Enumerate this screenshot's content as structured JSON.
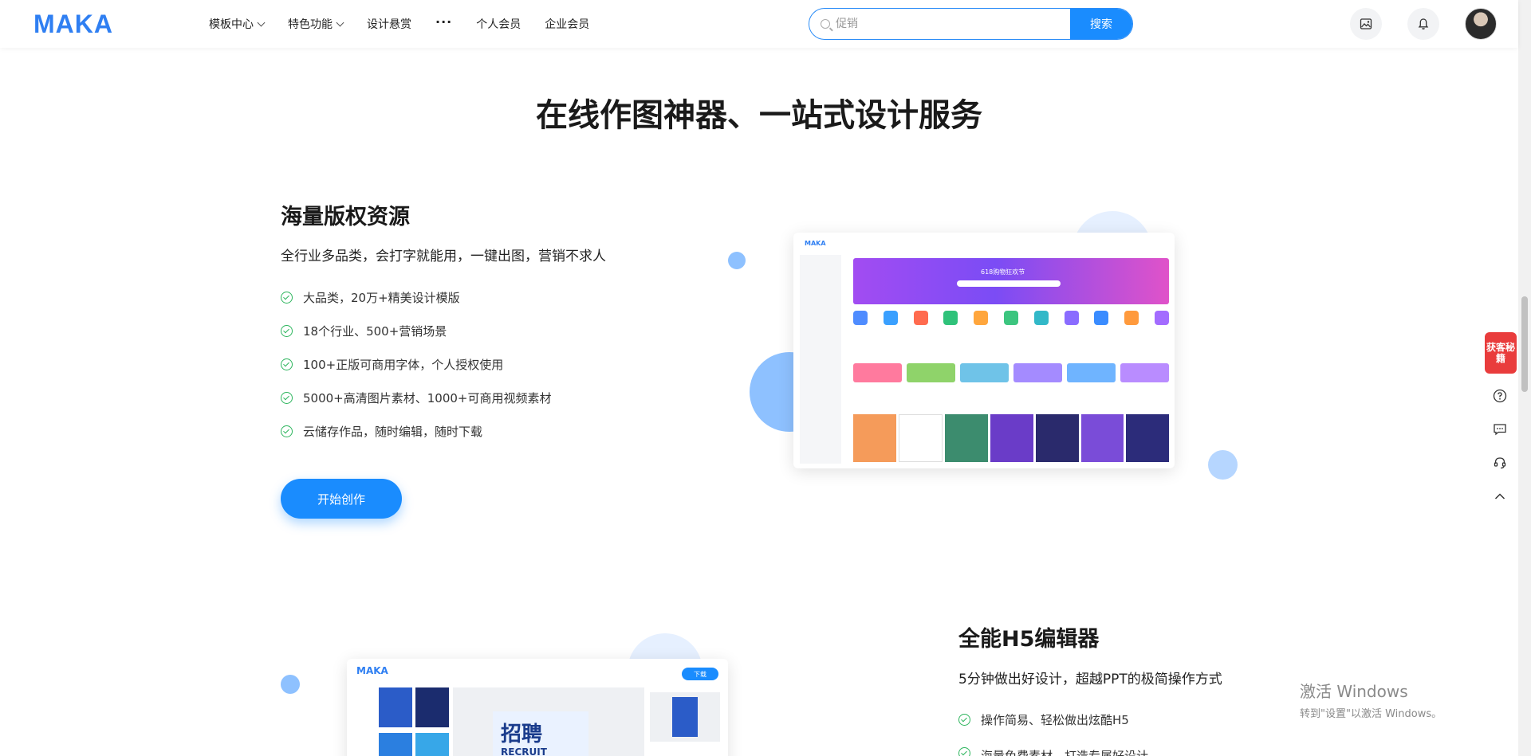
{
  "header": {
    "logo": "MAKA",
    "nav": [
      {
        "label": "模板中心",
        "has_dropdown": true
      },
      {
        "label": "特色功能",
        "has_dropdown": true
      },
      {
        "label": "设计悬赏",
        "has_dropdown": false
      },
      {
        "label": "···",
        "has_dropdown": false
      },
      {
        "label": "个人会员",
        "has_dropdown": false
      },
      {
        "label": "企业会员",
        "has_dropdown": false
      }
    ],
    "search": {
      "placeholder": "促销",
      "button_label": "搜索"
    },
    "icons": [
      "image-icon",
      "bell-icon"
    ]
  },
  "main_title": "在线作图神器、一站式设计服务",
  "section1": {
    "title": "海量版权资源",
    "subtitle": "全行业多品类，会打字就能用，一键出图，营销不求人",
    "features": [
      "大品类，20万+精美设计模版",
      "18个行业、500+营销场景",
      "100+正版可商用字体，个人授权使用",
      "5000+高清图片素材、1000+可商用视频素材",
      "云储存作品，随时编辑，随时下载"
    ],
    "cta": "开始创作",
    "mock": {
      "logo": "MAKA",
      "banner": "618购物狂欢节"
    }
  },
  "section2": {
    "title": "全能H5编辑器",
    "subtitle": "5分钟做出好设计，超越PPT的极简操作方式",
    "features": [
      "操作简易、轻松做出炫酷H5",
      "海量免费素材，打造专属好设计"
    ],
    "mock": {
      "logo": "MAKA",
      "download": "下载",
      "poster_title": "招聘",
      "poster_sub": "RECRUIT"
    }
  },
  "floating": {
    "promo": "获客秘籍",
    "icons": [
      "help-icon",
      "chat-icon",
      "service-icon",
      "back-to-top-icon"
    ]
  },
  "watermark": {
    "line1": "激活 Windows",
    "line2": "转到\"设置\"以激活 Windows。"
  },
  "colors": {
    "primary": "#1a8cfe",
    "check": "#2db55d",
    "dot": "#8ec1ff"
  }
}
